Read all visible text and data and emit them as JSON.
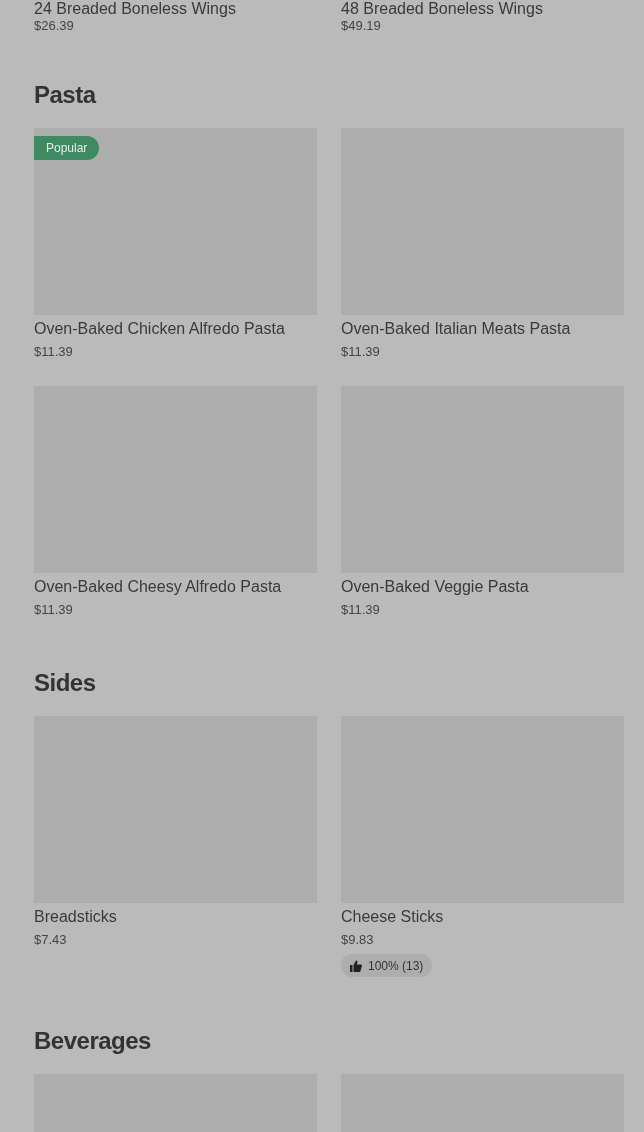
{
  "sections": [
    {
      "items": [
        {
          "name": "24 Breaded Boneless Wings",
          "price": "$26.39"
        },
        {
          "name": "48 Breaded Boneless Wings",
          "price": "$49.19"
        }
      ]
    },
    {
      "title": "Pasta",
      "items": [
        {
          "name": "Oven-Baked Chicken Alfredo Pasta",
          "price": "$11.39",
          "badge": "Popular",
          "kind": "placeholder"
        },
        {
          "name": "Oven-Baked Italian Meats Pasta",
          "price": "$11.39",
          "kind": "placeholder"
        },
        {
          "name": "Oven-Baked Cheesy Alfredo Pasta",
          "price": "$11.39",
          "kind": "placeholder"
        },
        {
          "name": "Oven-Baked Veggie Pasta",
          "price": "$11.39",
          "kind": "placeholder"
        }
      ]
    },
    {
      "title": "Sides",
      "items": [
        {
          "name": "Breadsticks",
          "price": "$7.43",
          "kind": "placeholder"
        },
        {
          "name": "Cheese Sticks",
          "price": "$9.83",
          "rating": "100% (13)",
          "kind": "placeholder"
        }
      ]
    },
    {
      "title": "Beverages",
      "items": [
        {
          "kind": "placeholder"
        },
        {
          "kind": "placeholder"
        }
      ]
    }
  ]
}
